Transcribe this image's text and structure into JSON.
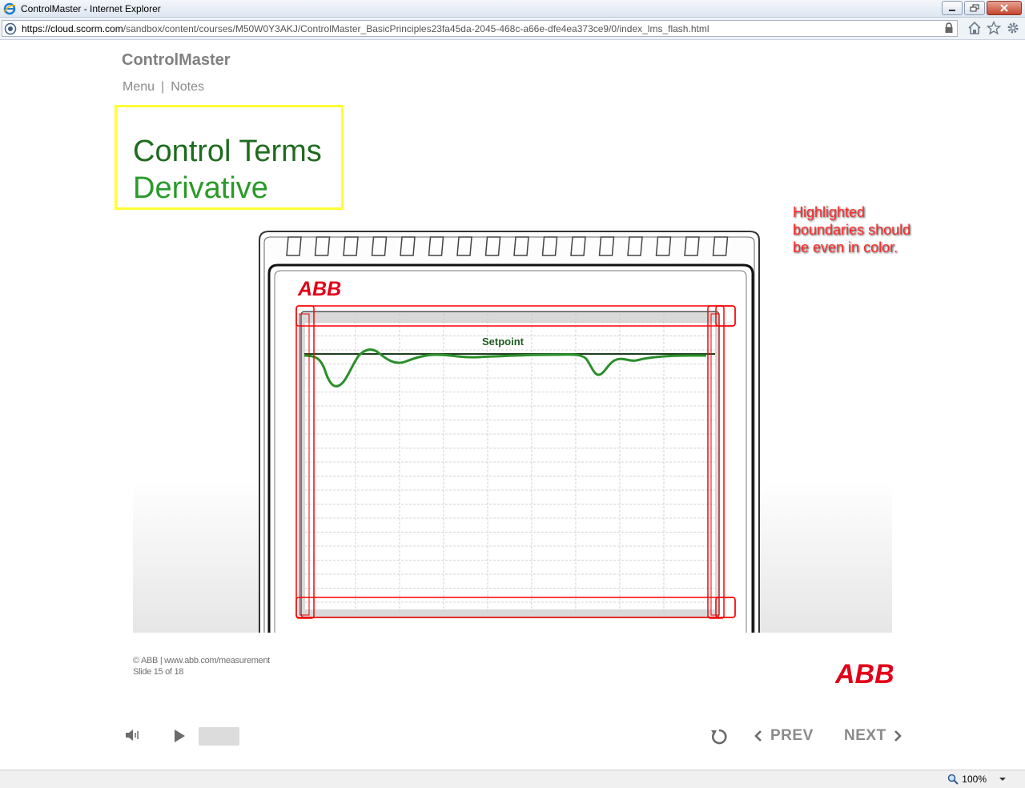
{
  "browser": {
    "window_title": "ControlMaster - Internet Explorer",
    "url_prefix": "https://",
    "url_host": "cloud.scorm.com",
    "url_path": "/sandbox/content/courses/M50W0Y3AKJ/ControlMaster_BasicPrinciples23fa45da-2045-468c-a66e-dfe4ea373ce9/0/index_lms_flash.html",
    "zoom": "100%"
  },
  "course": {
    "brand": "ControlMaster",
    "nav": {
      "menu": "Menu",
      "separator": "|",
      "notes": "Notes"
    },
    "title_line1": "Control Terms",
    "title_line2": "Derivative"
  },
  "device": {
    "logo": "ABB",
    "setpoint_label": "Setpoint"
  },
  "annotation": {
    "line1": "Highlighted",
    "line2": "boundaries should",
    "line3": "be even in color."
  },
  "footer": {
    "copyright": "© ABB | www.abb.com/measurement",
    "slide": "Slide 15 of 18",
    "logo": "ABB"
  },
  "controls": {
    "prev": "PREV",
    "next": "NEXT",
    "icons": [
      "speaker-icon",
      "play-icon",
      "replay-icon",
      "chevron-left-icon",
      "chevron-right-icon"
    ]
  },
  "colors": {
    "title_dark": "#1f6b1f",
    "title_light": "#2a9a2a",
    "highlight_red": "#ff0000",
    "abb_red": "#e2001a",
    "box_border": "#ffff33"
  }
}
